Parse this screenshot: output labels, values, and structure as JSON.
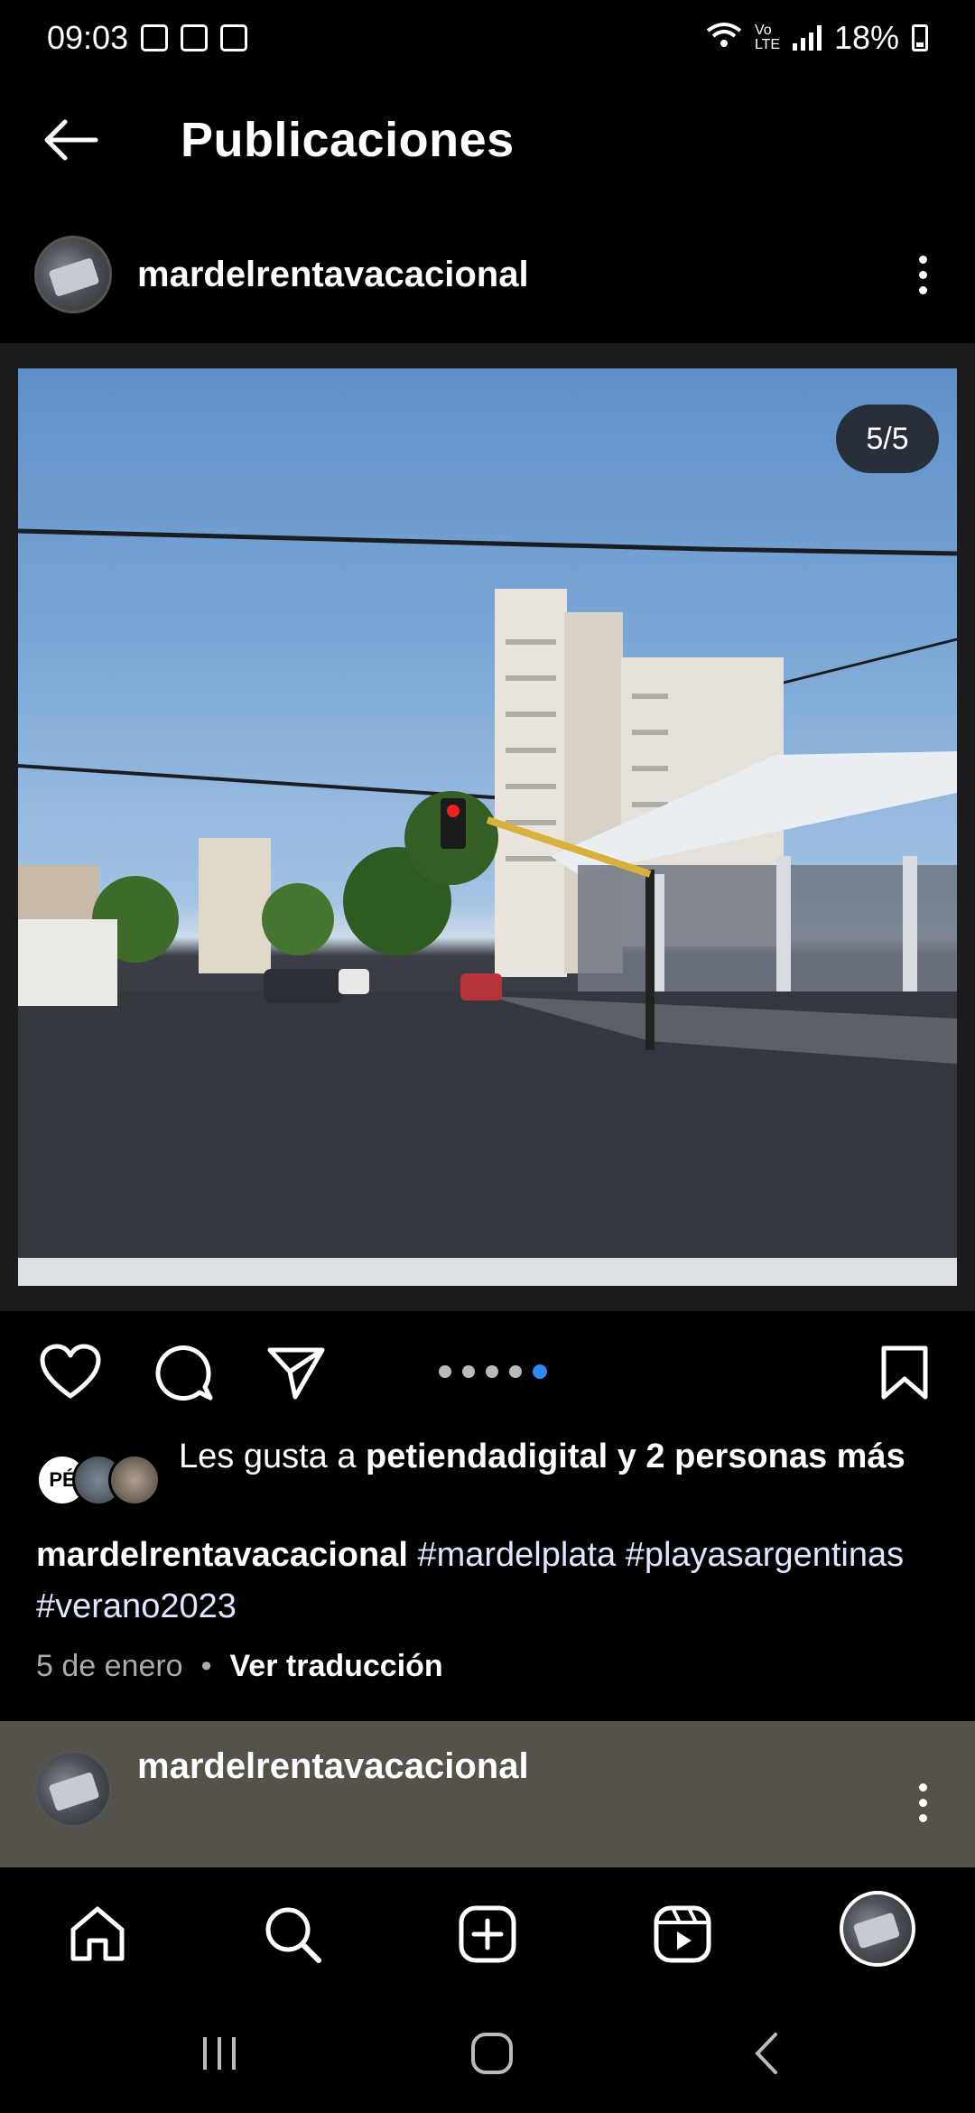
{
  "status_bar": {
    "time": "09:03",
    "network": "Vo LTE",
    "battery": "18%"
  },
  "header": {
    "title": "Publicaciones"
  },
  "post": {
    "username": "mardelrentavacacional",
    "image_counter": "5/5",
    "carousel": {
      "total": 5,
      "active_index": 5
    },
    "likes": {
      "prefix": "Les gusta a ",
      "user": "petiendadigital",
      "suffix": " y 2 personas más",
      "avatar_initials": "PÉ"
    },
    "caption": {
      "username": "mardelrentavacacional",
      "text": "#mardelplata #playasargentinas #verano2023"
    },
    "date": "5 de enero",
    "separator": "•",
    "translate": "Ver traducción"
  },
  "next_post": {
    "username": "mardelrentavacacional"
  },
  "bottom_nav": [
    "home-icon",
    "search-icon",
    "create-icon",
    "reels-icon",
    "profile-avatar"
  ],
  "colors": {
    "background": "#000000",
    "next_post_bg": "#545249",
    "active_dot": "#2d8cf0",
    "meta_gray": "#aaaaaa"
  }
}
